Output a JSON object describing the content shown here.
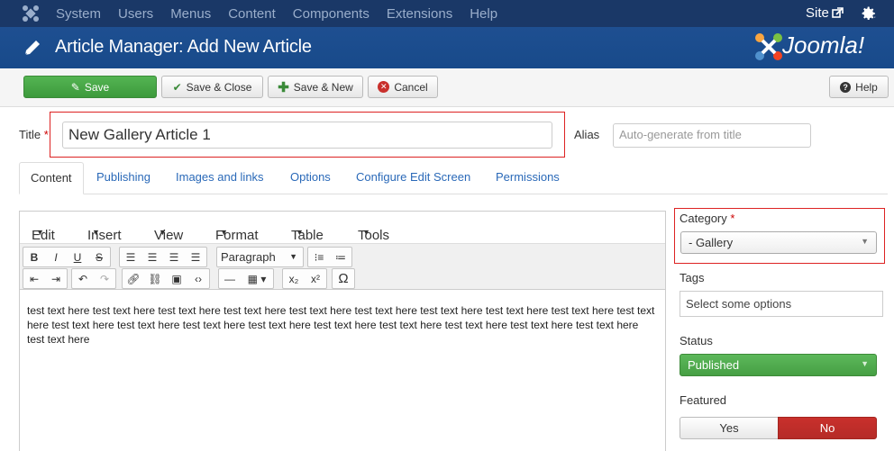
{
  "topnav": {
    "menu": [
      "System",
      "Users",
      "Menus",
      "Content",
      "Components",
      "Extensions",
      "Help"
    ],
    "site_label": "Site"
  },
  "header": {
    "title": "Article Manager: Add New Article",
    "logo_text": "Joomla!"
  },
  "toolbar": {
    "save": "Save",
    "save_close": "Save & Close",
    "save_new": "Save & New",
    "cancel": "Cancel",
    "help": "Help"
  },
  "form": {
    "title_label": "Title",
    "required_mark": "*",
    "title_value": "New Gallery Article 1",
    "alias_label": "Alias",
    "alias_placeholder": "Auto-generate from title"
  },
  "tabs": [
    "Content",
    "Publishing",
    "Images and links",
    "Options",
    "Configure Edit Screen",
    "Permissions"
  ],
  "editor": {
    "menus": [
      "Edit",
      "Insert",
      "View",
      "Format",
      "Table",
      "Tools"
    ],
    "paragraph_format": "Paragraph",
    "content": "test text here test text here test text here test text here test text here test text here test text here test text here test text here test text here test text here test text here test text here test text here test text here test text here test text here test text here test text here test text here"
  },
  "sidebar": {
    "category_label": "Category",
    "category_value": "- Gallery",
    "tags_label": "Tags",
    "tags_placeholder": "Select some options",
    "status_label": "Status",
    "status_value": "Published",
    "featured_label": "Featured",
    "featured_yes": "Yes",
    "featured_no": "No",
    "featured_selected": "No"
  },
  "colors": {
    "topnav_bg": "#1a3867",
    "header_bg": "#1e4f91",
    "save_green": "#46a546",
    "link_blue": "#2a69b8",
    "no_red": "#bd362f",
    "highlight_red": "#dd2222"
  }
}
